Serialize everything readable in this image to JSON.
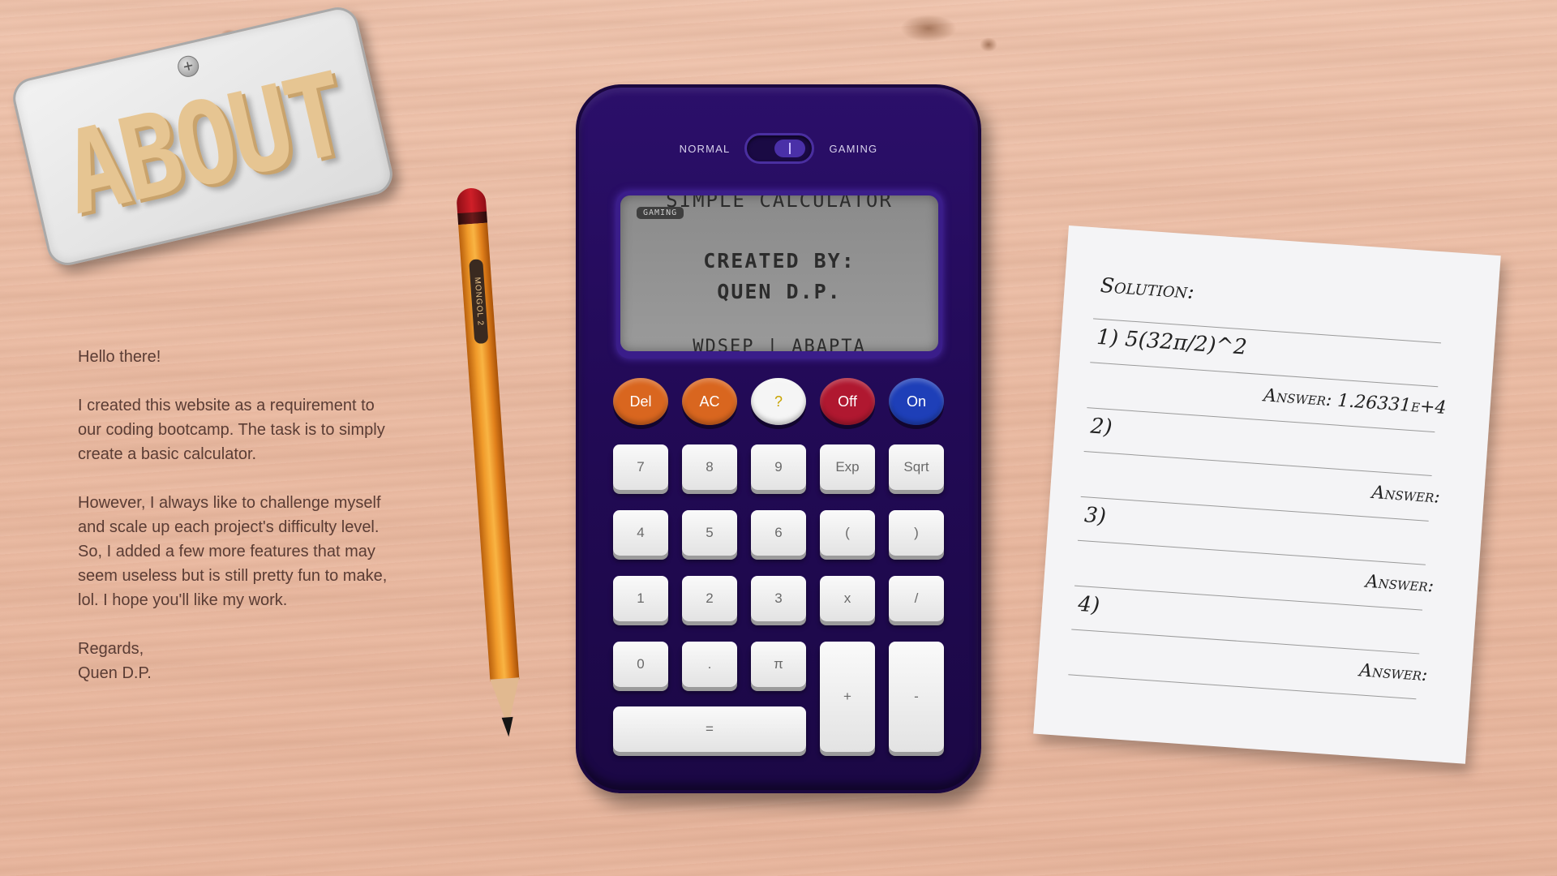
{
  "sign": {
    "text": "ABOUT",
    "screw": "+"
  },
  "letter": {
    "greeting": "Hello there!",
    "paragraph1": "I created this website as a requirement to our coding bootcamp. The task is to simply create a basic calculator.",
    "paragraph2": "However, I always like to challenge myself and scale up each project's difficulty level. So, I added a few more features that may seem useless but is still pretty fun to make, lol. I hope you'll like my work.",
    "closing": "Regards,",
    "signature": "Quen D.P."
  },
  "pencil": {
    "brand": "MONGOL 2"
  },
  "calculator": {
    "mode_left": "NORMAL",
    "mode_right": "GAMING",
    "mode_selected": "GAMING",
    "screen": {
      "badge": "GAMING",
      "line1": "SIMPLE CALCULATOR",
      "line2": "CREATED BY:",
      "line3": "QUEN D.P.",
      "line4": "WDSEP | ABAPTA"
    },
    "function_buttons": [
      {
        "label": "Del",
        "color": "#d9661f"
      },
      {
        "label": "AC",
        "color": "#d9661f"
      },
      {
        "label": "?",
        "color": "#f5f5f5"
      },
      {
        "label": "Off",
        "color": "#b01830"
      },
      {
        "label": "On",
        "color": "#1e3fb8"
      }
    ],
    "keys": {
      "k7": "7",
      "k8": "8",
      "k9": "9",
      "exp": "Exp",
      "sqrt": "Sqrt",
      "k4": "4",
      "k5": "5",
      "k6": "6",
      "lparen": "(",
      "rparen": ")",
      "k1": "1",
      "k2": "2",
      "k3": "3",
      "mul": "x",
      "div": "/",
      "k0": "0",
      "dot": ".",
      "pi": "π",
      "plus": "+",
      "minus": "-",
      "equals": "="
    }
  },
  "note": {
    "title": "Solution:",
    "items": [
      {
        "number": "1)",
        "expression": "5(32π/2)^2",
        "answer_label": "Answer:",
        "answer": "1.26331e+4"
      },
      {
        "number": "2)",
        "expression": "",
        "answer_label": "Answer:",
        "answer": ""
      },
      {
        "number": "3)",
        "expression": "",
        "answer_label": "Answer:",
        "answer": ""
      },
      {
        "number": "4)",
        "expression": "",
        "answer_label": "Answer:",
        "answer": ""
      }
    ]
  }
}
